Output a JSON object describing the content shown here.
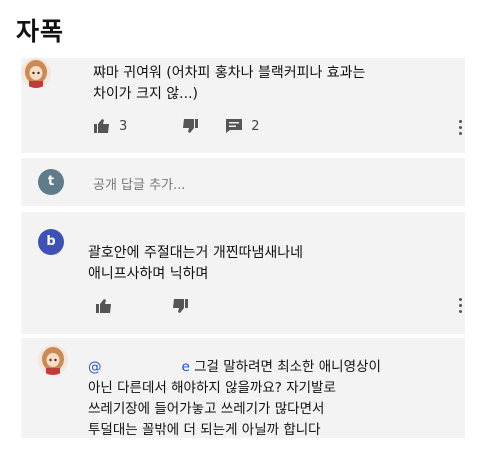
{
  "page_title": "자폭",
  "comments": [
    {
      "text_lines": [
        "쨔마 귀여워 (어차피 홍차나 블랙커피나 효과는",
        "차이가 크지 않...)"
      ],
      "likes": "3",
      "replies": "2"
    },
    {
      "avatar_letter": "t",
      "placeholder": "공개 답글 추가..."
    },
    {
      "avatar_letter": "b",
      "text_lines": [
        "괄호안에 주절대는거 개찐따냄새나네",
        "애니프사하며 닉하며"
      ]
    },
    {
      "mention_at": "@",
      "mention_tail": "e",
      "text_lines": [
        "그걸 말하려면 최소한 애니영상이",
        "아닌 다른데서 해야하지 않을까요? 자기발로",
        "쓰레기장에 들어가놓고 쓰레기가 많다면서",
        "투덜대는 꼴밖에 더 되는게 아닐까 합니다"
      ]
    }
  ],
  "colors": {
    "avatar_t": "#5f7c8a",
    "avatar_b": "#3f51b5",
    "card_bg": "#f3f3f3",
    "mention": "#1a56b8"
  },
  "icons": [
    "thumb-up-icon",
    "thumb-down-icon",
    "reply-comment-icon",
    "more-vert-icon"
  ]
}
